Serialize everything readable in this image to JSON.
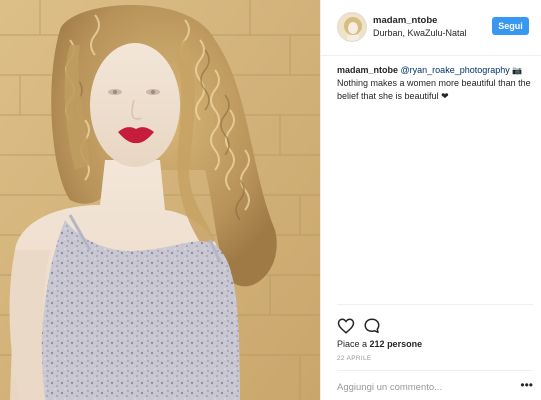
{
  "post": {
    "username": "madam_ntobe",
    "location": "Durban, KwaZulu-Natal",
    "follow_label": "Segui",
    "caption": {
      "user": "madam_ntobe",
      "mention": "@ryan_roake_photography",
      "camera_glyph": "📷",
      "text": "Nothing makes a women more beautiful than the belief that she is beautiful",
      "heart_glyph": "❤"
    },
    "likes_prefix": "Piace a",
    "likes_count": "212 persone",
    "date": "22 APRILE",
    "comment_placeholder": "Aggiungi un commento...",
    "more_glyph": "•••"
  },
  "icons": {
    "like": "heart-outline-icon",
    "comment": "speech-bubble-icon"
  },
  "colors": {
    "follow_button": "#3897f0",
    "mention": "#003569",
    "wall": "#d6b77e"
  }
}
